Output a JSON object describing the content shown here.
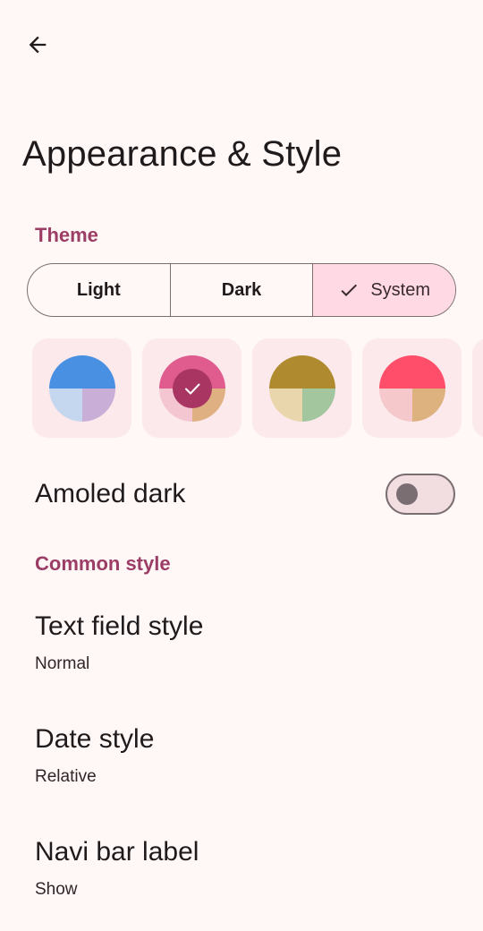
{
  "header": {
    "back_icon": "arrow-back-icon",
    "title": "Appearance & Style"
  },
  "theme_section": {
    "label": "Theme",
    "modes": [
      {
        "label": "Light",
        "selected": false
      },
      {
        "label": "Dark",
        "selected": false
      },
      {
        "label": "System",
        "selected": true,
        "icon": "check-icon"
      }
    ]
  },
  "color_swatches": [
    {
      "name": "blue",
      "primary": "#4A90E2",
      "secondary": "#C5D7EE",
      "tertiary": "#C9AED8",
      "selected": false
    },
    {
      "name": "pink",
      "primary": "#E05C8E",
      "secondary": "#F3C6D2",
      "tertiary": "#DFB082",
      "selected": true,
      "center": "#A93662"
    },
    {
      "name": "olive",
      "primary": "#B08A2E",
      "secondary": "#EAD6AC",
      "tertiary": "#A3C69F",
      "selected": false
    },
    {
      "name": "red",
      "primary": "#FF4E6A",
      "secondary": "#F5C8CB",
      "tertiary": "#DDB27E",
      "selected": false
    }
  ],
  "amoled_dark": {
    "label": "Amoled dark",
    "enabled": false
  },
  "common_style": {
    "label": "Common style",
    "items": [
      {
        "title": "Text field style",
        "value": "Normal"
      },
      {
        "title": "Date style",
        "value": "Relative"
      },
      {
        "title": "Navi bar label",
        "value": "Show"
      }
    ]
  },
  "colors": {
    "background": "#FFF8F7",
    "accent": "#9C3D66",
    "selected_segment": "#FFD9E3",
    "card": "#FCE9EC",
    "outline": "#7A6E72"
  }
}
